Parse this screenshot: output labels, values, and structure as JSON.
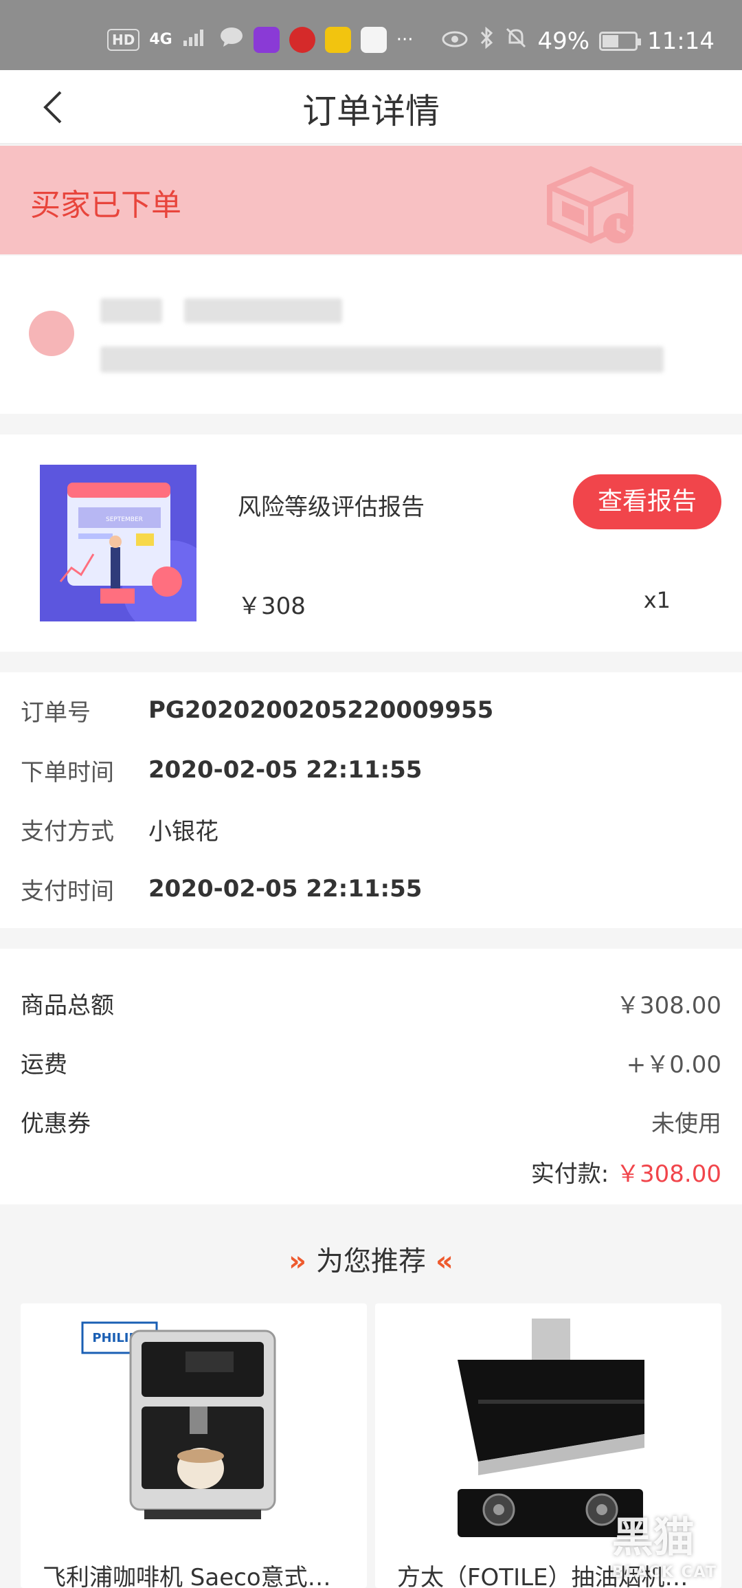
{
  "status_bar": {
    "network_badge": "HD",
    "signal": "4G",
    "battery_text": "49%",
    "battery_level": 0.49,
    "time": "11:14",
    "more": "···"
  },
  "navbar": {
    "title": "订单详情"
  },
  "banner": {
    "status_text": "买家已下单"
  },
  "product": {
    "name": "风险等级评估报告",
    "price": "￥308",
    "quantity": "x1",
    "report_button": "查看报告",
    "image_caption": "SEPTEMBER"
  },
  "order_info": [
    {
      "label": "订单号",
      "value": "PG2020200205220009955",
      "bold": true
    },
    {
      "label": "下单时间",
      "value": "2020-02-05 22:11:55",
      "bold": true
    },
    {
      "label": "支付方式",
      "value": "小银花",
      "bold": false
    },
    {
      "label": "支付时间",
      "value": "2020-02-05 22:11:55",
      "bold": true
    }
  ],
  "summary": {
    "rows": [
      {
        "label": "商品总额",
        "value": "￥308.00"
      },
      {
        "label": "运费",
        "value": "+￥0.00"
      },
      {
        "label": "优惠券",
        "value": "未使用"
      }
    ],
    "paid_label": "实付款:",
    "paid_value": "￥308.00"
  },
  "recommend": {
    "title": "为您推荐",
    "left_chevron": "»",
    "right_chevron": "«",
    "items": [
      {
        "name": "飞利浦咖啡机 Saeco意式全自动咖啡机",
        "brand": "PHILIPS"
      },
      {
        "name": "方太（FOTILE）抽油烟机灶具套装",
        "brand": ""
      }
    ]
  },
  "watermark": {
    "text": "黑猫",
    "sub": "BLACK CAT"
  },
  "colors": {
    "accent": "#f1454b",
    "banner_bg": "#f8c1c3",
    "banner_text": "#e8453c",
    "status_bar": "#8e8e8e"
  }
}
